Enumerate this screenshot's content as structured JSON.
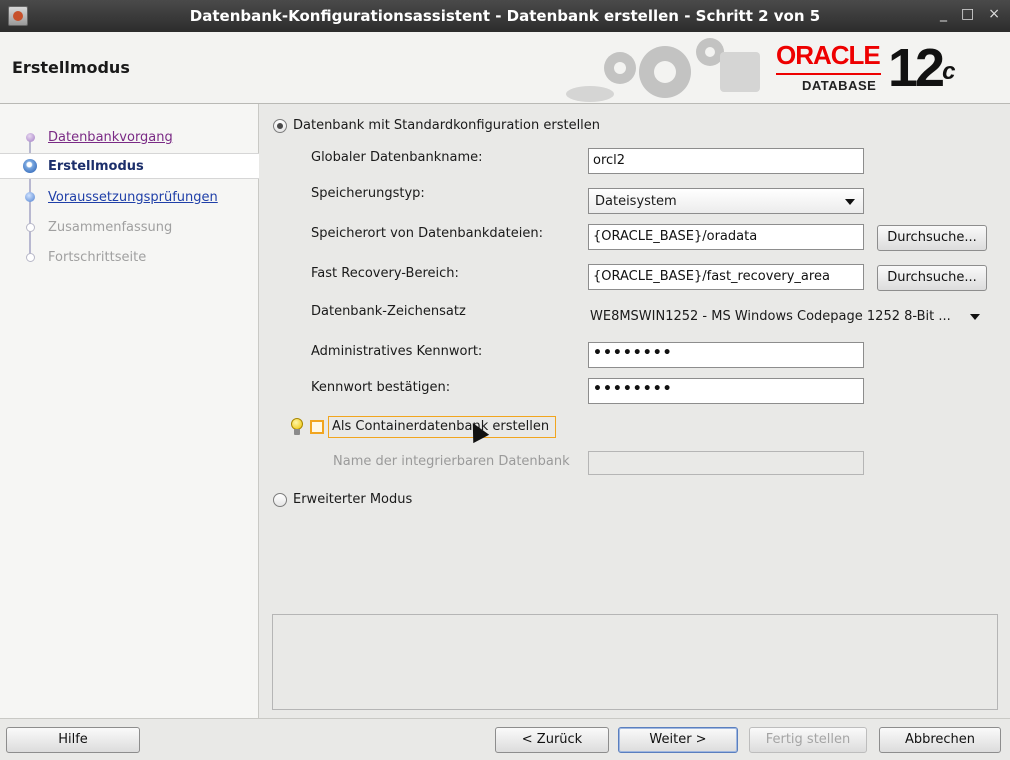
{
  "window": {
    "title": "Datenbank-Konfigurationsassistent - Datenbank erstellen - Schritt 2 von 5",
    "minimize": "_",
    "maximize": "□",
    "close": "×"
  },
  "header": {
    "title": "Erstellmodus",
    "logo_oracle": "ORACLE",
    "logo_database": "DATABASE",
    "logo_version": "12",
    "logo_version_suffix": "c"
  },
  "sidebar": {
    "items": [
      {
        "label": "Datenbankvorgang",
        "state": "done"
      },
      {
        "label": "Erstellmodus",
        "state": "active"
      },
      {
        "label": "Voraussetzungsprüfungen",
        "state": "next"
      },
      {
        "label": "Zusammenfassung",
        "state": "disabled"
      },
      {
        "label": "Fortschrittseite",
        "state": "disabled"
      }
    ]
  },
  "form": {
    "default_config_radio_label": "Datenbank mit Standardkonfiguration erstellen",
    "global_db_name_label": "Globaler Datenbankname:",
    "global_db_name_value": "orcl2",
    "storage_type_label": "Speicherungstyp:",
    "storage_type_value": "Dateisystem",
    "db_files_location_label": "Speicherort von Datenbankdateien:",
    "db_files_location_value": "{ORACLE_BASE}/oradata",
    "browse_label": "Durchsuche...",
    "fast_recovery_label": "Fast Recovery-Bereich:",
    "fast_recovery_value": "{ORACLE_BASE}/fast_recovery_area",
    "charset_label": "Datenbank-Zeichensatz",
    "charset_value": "WE8MSWIN1252 - MS Windows Codepage 1252 8-Bit ...",
    "admin_password_label": "Administratives Kennwort:",
    "admin_password_value": "••••••••",
    "confirm_password_label": "Kennwort bestätigen:",
    "confirm_password_value": "••••••••",
    "container_db_checkbox_label": "Als Containerdatenbank erstellen",
    "pluggable_db_name_label": "Name der integrierbaren Datenbank",
    "pluggable_db_name_value": "",
    "advanced_mode_radio_label": "Erweiterter Modus"
  },
  "footer": {
    "help_label": "Hilfe",
    "back_label": "< Zurück",
    "next_label": "Weiter >",
    "finish_label": "Fertig stellen",
    "cancel_label": "Abbrechen"
  },
  "colors": {
    "oracle_red": "#e00000",
    "titlebar_bg": "#3a3a3a",
    "focus_orange": "#f1a51f",
    "link_blue": "#1f3fa8",
    "visited_purple": "#7a2a85"
  }
}
